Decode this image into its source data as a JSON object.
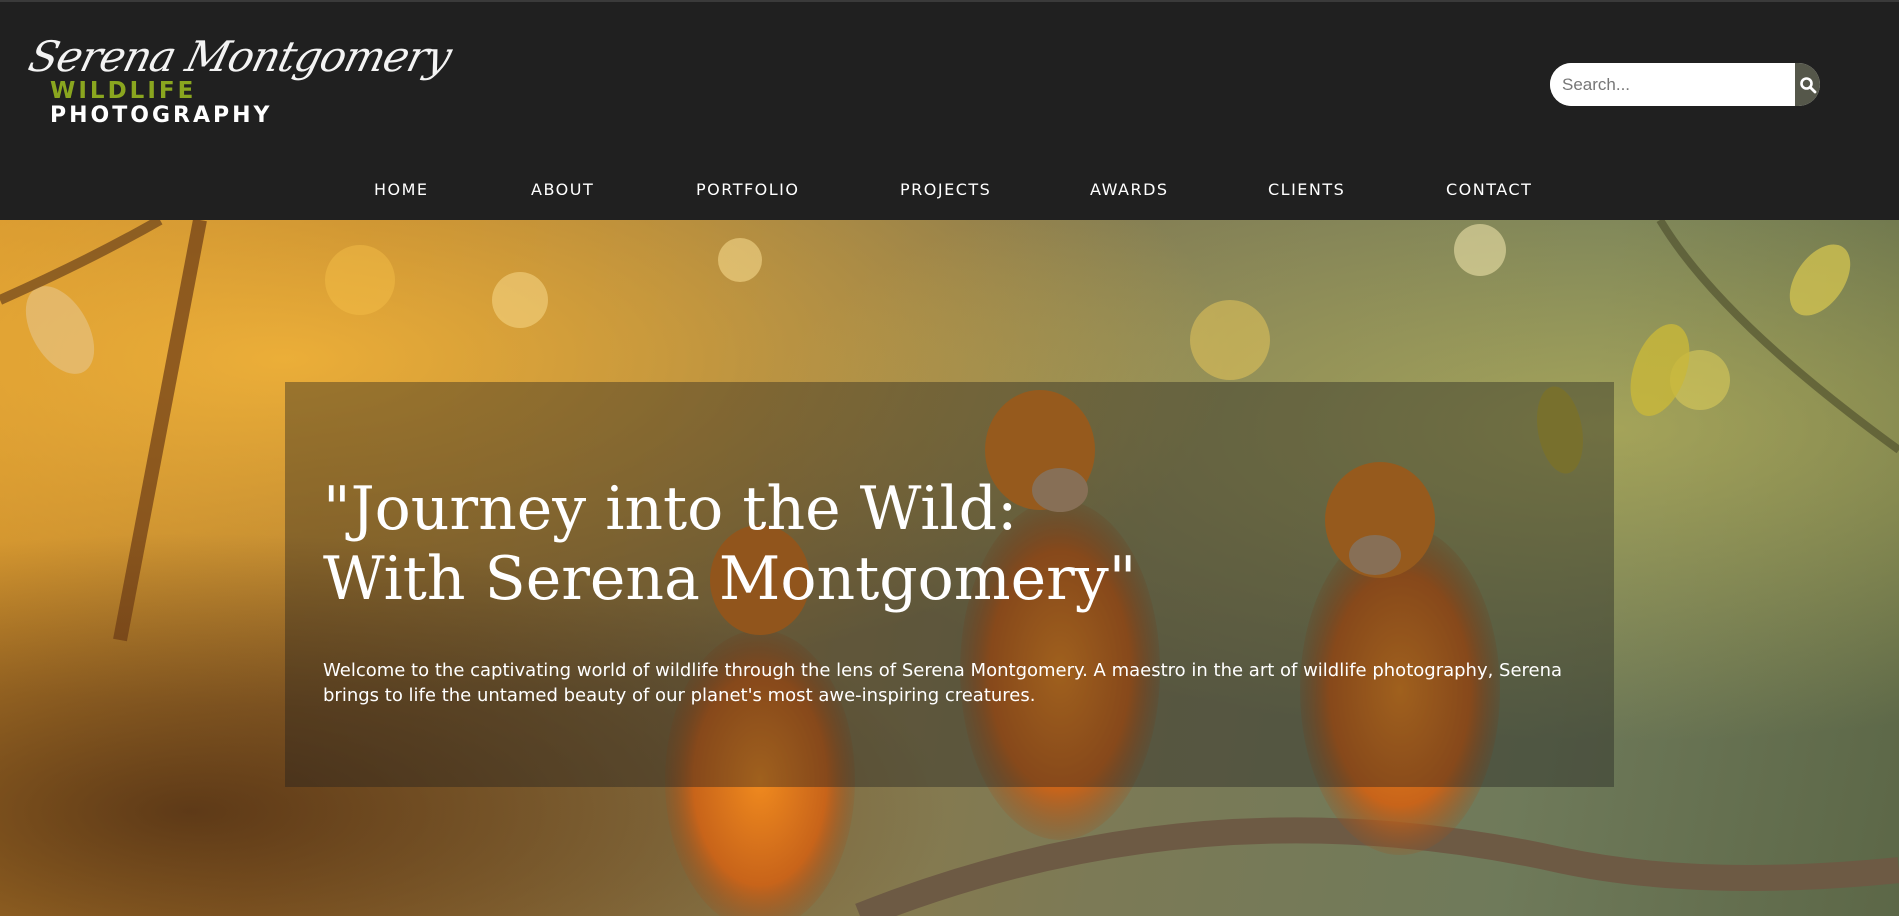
{
  "brand": {
    "script_name": "Serena Montgomery",
    "line1": "WILDLIFE",
    "line2": "PHOTOGRAPHY",
    "accent_color": "#8aa61f"
  },
  "search": {
    "placeholder": "Search...",
    "button_icon": "search-icon"
  },
  "nav": {
    "items": [
      {
        "label": "HOME"
      },
      {
        "label": "ABOUT"
      },
      {
        "label": "PORTFOLIO"
      },
      {
        "label": "PROJECTS"
      },
      {
        "label": "AWARDS"
      },
      {
        "label": "CLIENTS"
      },
      {
        "label": "CONTACT"
      }
    ]
  },
  "hero": {
    "title_line1": "\"Journey into the Wild:",
    "title_line2": "With Serena Montgomery\"",
    "text": "Welcome to the captivating world of wildlife through the lens of Serena Montgomery. A maestro in the art of wildlife photography, Serena brings to life the untamed beauty of our planet's most awe-inspiring creatures.",
    "background_image": "three orange monkeys sitting on a branch in golden forest light"
  },
  "colors": {
    "header_bg": "#202020",
    "search_button": "#55574a"
  }
}
